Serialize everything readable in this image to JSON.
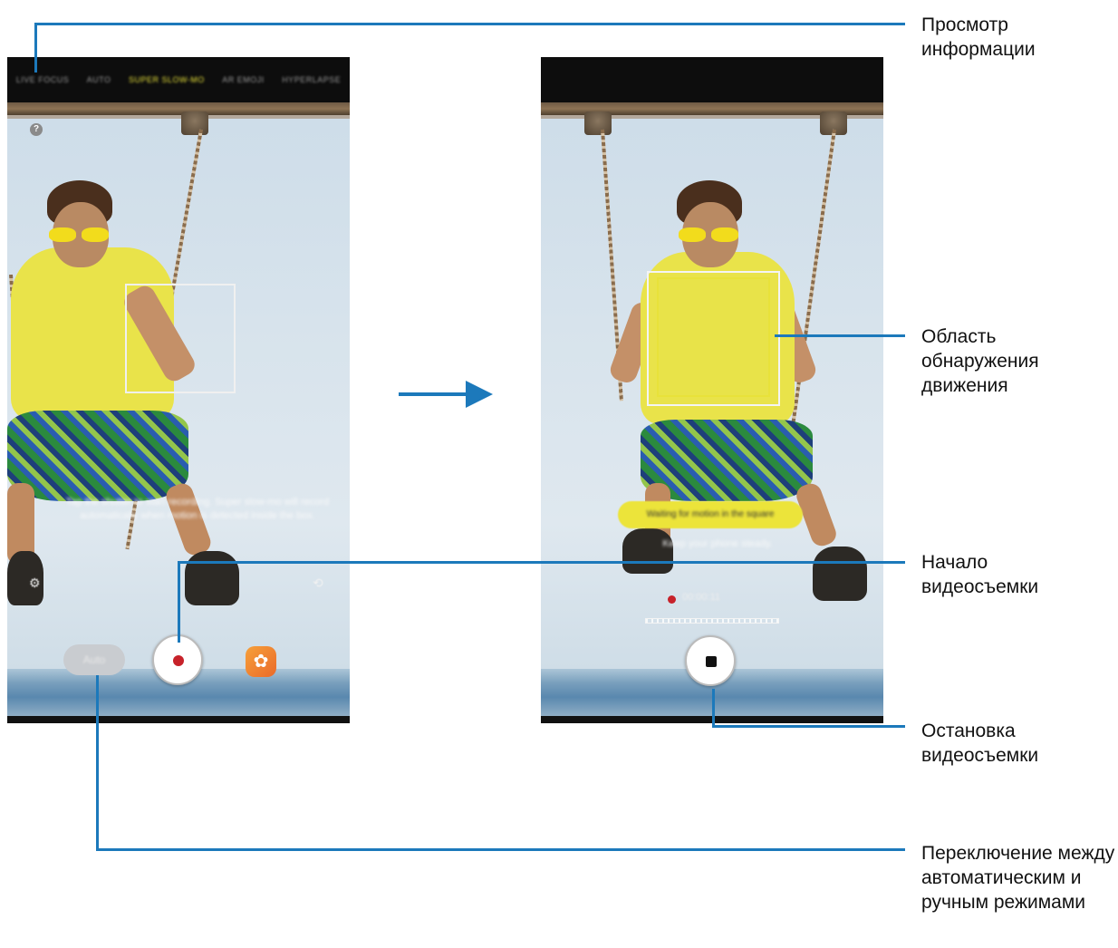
{
  "left_screen": {
    "mode_tabs": [
      "LIVE FOCUS",
      "AUTO",
      "SUPER SLOW-MO",
      "AR EMOJI",
      "HYPERLAPSE"
    ],
    "active_mode": "SUPER SLOW-MO",
    "help_icon": "?",
    "hint_text": "Tap the shutter to start recording. Super slow-mo will record automatically when motion is detected inside the box.",
    "auto_button": "Auto",
    "effects_icon": "flower-icon"
  },
  "right_screen": {
    "status_pill": "Waiting for motion in the square",
    "hint_text": "Keep your phone steady.",
    "timer": "00:00:11"
  },
  "callouts": {
    "view_info": "Просмотр информации",
    "motion_area": "Область обнаружения движения",
    "start_recording": "Начало видеосъемки",
    "stop_recording": "Остановка видеосъемки",
    "switch_modes": "Переключение между автоматическим и ручным режимами"
  },
  "colors": {
    "callout_blue": "#1c79bb",
    "record_red": "#c7222a",
    "highlight_yellow": "#e8e23a"
  }
}
